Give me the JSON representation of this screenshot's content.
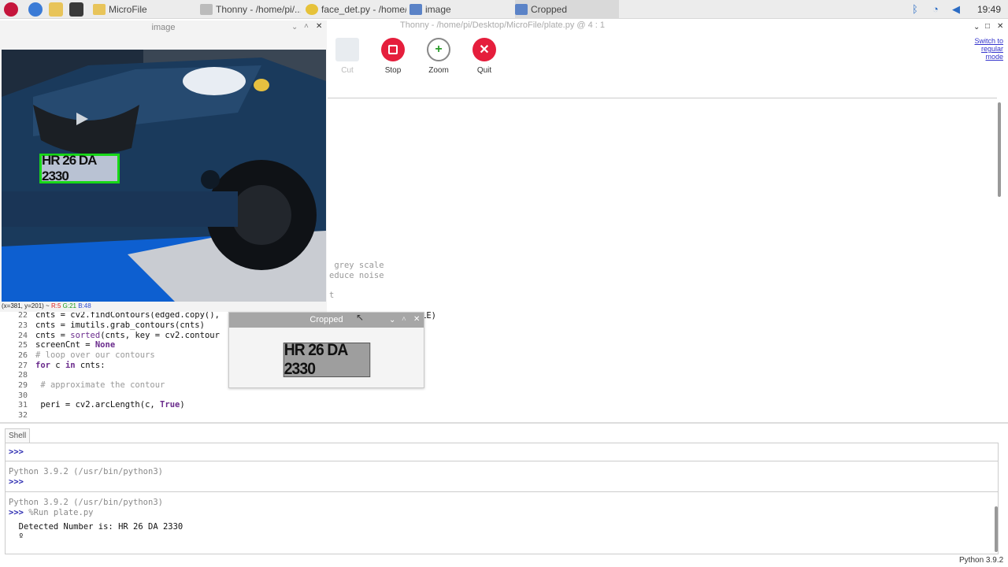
{
  "taskbar": {
    "tasks": [
      {
        "label": "MicroFile"
      },
      {
        "label": "Thonny  -  /home/pi/..."
      },
      {
        "label": "face_det.py - /home/..."
      },
      {
        "label": "image"
      },
      {
        "label": "Cropped"
      }
    ],
    "clock": "19:49"
  },
  "image_window": {
    "title": "image",
    "plate_text": "HR 26 DA 2330",
    "coords_prefix": "(x=381, y=201) ~ ",
    "coords_r": "R:5",
    "coords_g": "G:21",
    "coords_b": "B:48"
  },
  "thonny": {
    "title": "Thonny  -  /home/pi/Desktop/MicroFile/plate.py  @  4 : 1",
    "toolbar": {
      "cut": "Cut",
      "stop": "Stop",
      "zoom": "Zoom",
      "quit": "Quit"
    },
    "switch_mode": [
      "Switch to",
      "regular",
      "mode"
    ],
    "code_fragments": {
      "f1": " grey scale",
      "f2": "educe noise",
      "f3": "t",
      "f4": "LE)"
    },
    "code": {
      "l22": "cnts = cv2.findContours(edged.copy(),",
      "l23": "cnts = imutils.grab_contours(cnts)",
      "l24a": "cnts = ",
      "l24b": "sorted",
      "l24c": "(cnts, key = cv2.contour",
      "l25a": "screenCnt = ",
      "l25b": "None",
      "l26": "# loop over our contours",
      "l27a": "for",
      "l27b": " c ",
      "l27c": "in",
      "l27d": " cnts:",
      "l29": " # approximate the contour",
      "l31a": " peri = cv2.arcLength(c, ",
      "l31b": "True",
      "l31c": ")"
    },
    "line_numbers": [
      "22",
      "23",
      "24",
      "25",
      "26",
      "27",
      "28",
      "29",
      "30",
      "31",
      "32"
    ],
    "shell_tab": "Shell",
    "shell": {
      "p1": ">>>",
      "v1": "Python 3.9.2 (/usr/bin/python3)",
      "p2": ">>>",
      "v2": "Python 3.9.2 (/usr/bin/python3)",
      "p3": ">>>",
      "run": " %Run plate.py",
      "output": "  Detected Number is: HR 26 DA 2330",
      "output2": "  º"
    },
    "status": "Python 3.9.2"
  },
  "cropped_window": {
    "title": "Cropped",
    "plate_text": "HR 26 DA 2330"
  }
}
